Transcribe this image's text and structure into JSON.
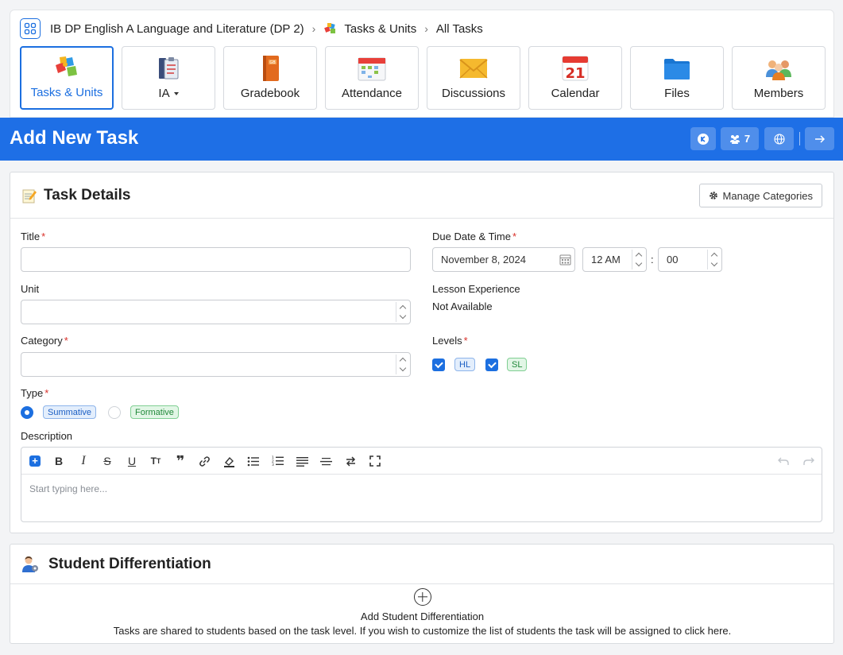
{
  "breadcrumb": {
    "course": "IB DP English A Language and Literature (DP 2)",
    "section": "Tasks & Units",
    "current": "All Tasks"
  },
  "nav_tabs": [
    {
      "label": "Tasks & Units",
      "icon": "puzzle-icon",
      "active": true
    },
    {
      "label": "IA",
      "icon": "clipboard-books-icon",
      "has_dropdown": true
    },
    {
      "label": "Gradebook",
      "icon": "gradebook-icon"
    },
    {
      "label": "Attendance",
      "icon": "attendance-calendar-icon"
    },
    {
      "label": "Discussions",
      "icon": "envelope-icon"
    },
    {
      "label": "Calendar",
      "icon": "calendar-icon",
      "calendar_day": "21"
    },
    {
      "label": "Files",
      "icon": "folder-icon"
    },
    {
      "label": "Members",
      "icon": "people-icon"
    }
  ],
  "header": {
    "title": "Add New Task",
    "member_count": "7",
    "accent_color": "#1e6fe6"
  },
  "task_details": {
    "heading": "Task Details",
    "manage_categories": "Manage Categories",
    "title_label": "Title",
    "title_value": "",
    "due_label": "Due Date & Time",
    "due_date": "November 8, 2024",
    "due_hour": "12 AM",
    "due_colon": ":",
    "due_minute": "00",
    "unit_label": "Unit",
    "lesson_label": "Lesson Experience",
    "lesson_value": "Not Available",
    "category_label": "Category",
    "levels_label": "Levels",
    "levels": [
      {
        "label": "HL",
        "checked": true
      },
      {
        "label": "SL",
        "checked": true
      }
    ],
    "type_label": "Type",
    "types": [
      {
        "label": "Summative",
        "selected": true
      },
      {
        "label": "Formative",
        "selected": false
      }
    ],
    "description_label": "Description",
    "description_placeholder": "Start typing here...",
    "required_mark": "*"
  },
  "differentiation": {
    "heading": "Student Differentiation",
    "add_label": "Add Student Differentiation",
    "help_text": "Tasks are shared to students based on the task level. If you wish to customize the list of students the task will be assigned to click here."
  }
}
